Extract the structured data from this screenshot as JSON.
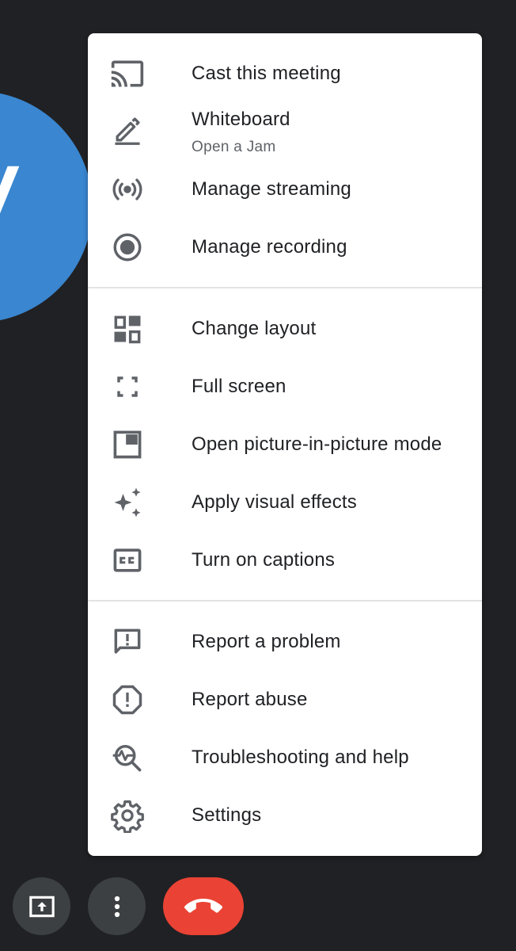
{
  "background": {
    "color": "#202124",
    "avatar_color": "#3a86d0",
    "avatar_letter": "V"
  },
  "menu": {
    "sections": [
      {
        "items": [
          {
            "icon": "cast-icon",
            "label": "Cast this meeting"
          },
          {
            "icon": "pen-icon",
            "label": "Whiteboard",
            "sublabel": "Open a Jam"
          },
          {
            "icon": "streaming-icon",
            "label": "Manage streaming"
          },
          {
            "icon": "record-icon",
            "label": "Manage recording"
          }
        ]
      },
      {
        "items": [
          {
            "icon": "layout-icon",
            "label": "Change layout"
          },
          {
            "icon": "fullscreen-icon",
            "label": "Full screen"
          },
          {
            "icon": "picture-in-picture-icon",
            "label": "Open picture-in-picture mode"
          },
          {
            "icon": "sparkle-icon",
            "label": "Apply visual effects"
          },
          {
            "icon": "captions-icon",
            "label": "Turn on captions"
          }
        ]
      },
      {
        "items": [
          {
            "icon": "feedback-icon",
            "label": "Report a problem"
          },
          {
            "icon": "report-icon",
            "label": "Report abuse"
          },
          {
            "icon": "troubleshoot-icon",
            "label": "Troubleshooting and help"
          },
          {
            "icon": "gear-icon",
            "label": "Settings"
          }
        ]
      }
    ]
  },
  "toolbar": {
    "buttons": [
      {
        "icon": "present-screen-icon"
      },
      {
        "icon": "more-options-icon"
      },
      {
        "icon": "hang-up-icon",
        "color": "#ea4335"
      }
    ]
  }
}
